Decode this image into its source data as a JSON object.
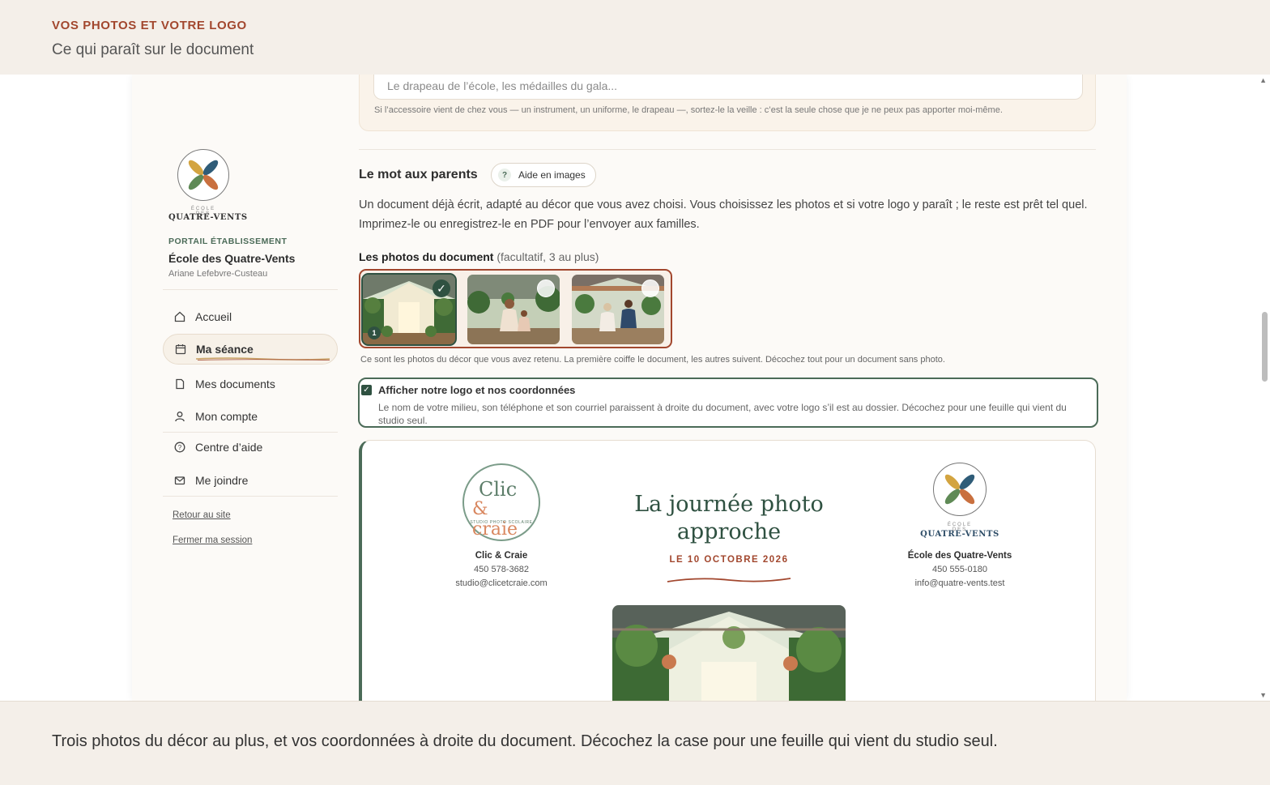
{
  "banner": {
    "kicker": "VOS PHOTOS ET VOTRE LOGO",
    "subtitle": "Ce qui paraît sur le document"
  },
  "sidebar": {
    "logo_small": "ÉCOLE DES",
    "logo_name": "QUATRE-VENTS",
    "portal_label": "PORTAIL ÉTABLISSEMENT",
    "school": "École des Quatre-Vents",
    "user": "Ariane Lefebvre-Custeau",
    "nav": [
      {
        "label": "Accueil",
        "icon": "home-icon",
        "active": false
      },
      {
        "label": "Ma séance",
        "icon": "calendar-icon",
        "active": true
      },
      {
        "label": "Mes documents",
        "icon": "document-icon",
        "active": false
      },
      {
        "label": "Mon compte",
        "icon": "user-icon",
        "active": false
      },
      {
        "label": "Centre d’aide",
        "icon": "help-icon",
        "active": false
      },
      {
        "label": "Me joindre",
        "icon": "mail-icon",
        "active": false
      }
    ],
    "links": [
      "Retour au site",
      "Fermer ma session"
    ]
  },
  "accessory": {
    "placeholder": "Le drapeau de l’école, les médailles du gala...",
    "hint": "Si l’accessoire vient de chez vous — un instrument, un uniforme, le drapeau —, sortez-le la veille : c’est la seule chose que je ne peux pas apporter moi-même."
  },
  "section": {
    "title": "Le mot aux parents",
    "help_label": "Aide en images",
    "help_icon": "question-icon",
    "intro": "Un document déjà écrit, adapté au décor que vous avez choisi. Vous choisissez les photos et si votre logo y paraît ; le reste est prêt tel quel. Imprimez-le ou enregistrez-le en PDF pour l’envoyer aux familles."
  },
  "photos": {
    "title": "Les photos du document",
    "qualifier": "(facultatif, 3 au plus)",
    "items": [
      {
        "selected": true,
        "order": "1"
      },
      {
        "selected": false,
        "order": ""
      },
      {
        "selected": false,
        "order": ""
      }
    ],
    "hint": "Ce sont les photos du décor que vous avez retenu. La première coiffe le document, les autres suivent. Décochez tout pour un document sans photo."
  },
  "logo_option": {
    "checked": true,
    "title": "Afficher notre logo et nos coordonnées",
    "description": "Le nom de votre milieu, son téléphone et son courriel paraissent à droite du document, avec votre logo s’il est au dossier. Décochez pour une feuille qui vient du studio seul."
  },
  "document": {
    "studio_logo": {
      "line1": "Clic",
      "line2": "& craie",
      "line3": "STUDIO PHOTO SCOLAIRE"
    },
    "studio": {
      "name": "Clic & Craie",
      "phone": "450 578-3682",
      "email": "studio@clicetcraie.com"
    },
    "title": "La journée photo approche",
    "date": "LE 10 OCTOBRE 2026",
    "school_logo_small": "ÉCOLE DES",
    "school_logo_name": "QUATRE-VENTS",
    "school": {
      "name": "École des Quatre-Vents",
      "phone": "450 555-0180",
      "email": "info@quatre-vents.test"
    }
  },
  "caption": "Trois photos du décor au plus, et vos coordonnées à droite du document. Décochez la case pour une feuille qui vient du studio seul.",
  "colors": {
    "accent_rust": "#a2472e",
    "accent_green": "#2f5141",
    "background": "#f4efe9"
  }
}
